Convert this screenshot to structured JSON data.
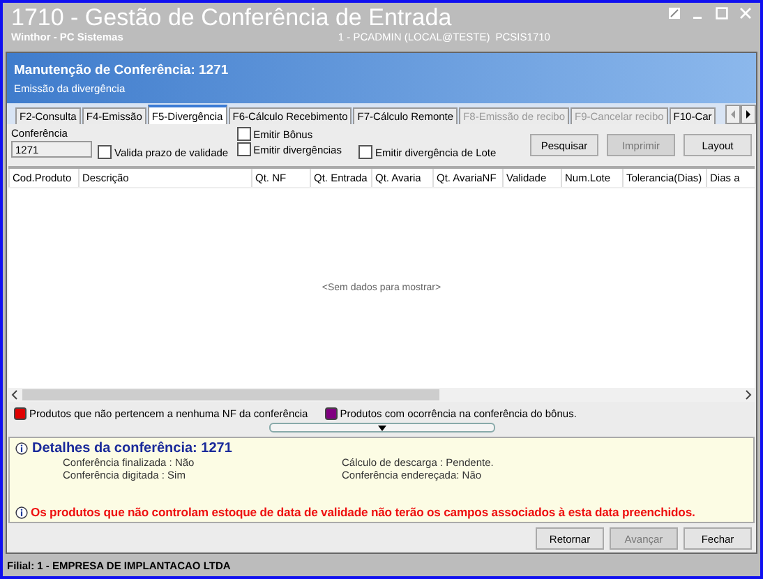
{
  "window": {
    "title": "1710 - Gestão de Conferência de Entrada",
    "subtitle": "Winthor - PC Sistemas",
    "session": "1 - PCADMIN (LOCAL@TESTE)",
    "program": "PCSIS1710"
  },
  "header": {
    "title": "Manutenção de Conferência: 1271",
    "subtitle": "Emissão da divergência"
  },
  "tabs": [
    {
      "label": "F2-Consulta",
      "selected": false,
      "disabled": false
    },
    {
      "label": "F4-Emissão",
      "selected": false,
      "disabled": false
    },
    {
      "label": "F5-Divergência",
      "selected": true,
      "disabled": false
    },
    {
      "label": "F6-Cálculo Recebimento",
      "selected": false,
      "disabled": false
    },
    {
      "label": "F7-Cálculo Remonte",
      "selected": false,
      "disabled": false
    },
    {
      "label": "F8-Emissão de recibo",
      "selected": false,
      "disabled": true
    },
    {
      "label": "F9-Cancelar recibo",
      "selected": false,
      "disabled": true
    },
    {
      "label": "F10-Car",
      "selected": false,
      "disabled": false
    }
  ],
  "form": {
    "field_label": "Conferência",
    "field_value": "1271",
    "checkboxes": [
      {
        "label": "Valida prazo de validade",
        "checked": false
      },
      {
        "label": "Emitir Bônus",
        "checked": false
      },
      {
        "label": "Emitir divergências",
        "checked": false
      },
      {
        "label": "Emitir divergência de Lote",
        "checked": false
      }
    ],
    "buttons": [
      {
        "label": "Pesquisar",
        "disabled": false
      },
      {
        "label": "Imprimir",
        "disabled": true
      },
      {
        "label": "Layout",
        "disabled": false
      }
    ]
  },
  "table": {
    "columns": [
      "Cod.Produto",
      "Descrição",
      "Qt. NF",
      "Qt. Entrada",
      "Qt. Avaria",
      "Qt. AvariaNF",
      "Validade",
      "Num.Lote",
      "Tolerancia(Dias)",
      "Dias a"
    ],
    "empty_message": "<Sem dados para mostrar>"
  },
  "legend": [
    {
      "label": "Produtos que não pertencem a nenhuma NF da conferência",
      "color": "#e00000"
    },
    {
      "label": "Produtos com ocorrência na conferência do bônus.",
      "color": "#800080"
    }
  ],
  "details": {
    "title": "Detalhes da conferência: 1271",
    "fields": [
      "Conferência finalizada : Não",
      "Cálculo de descarga : Pendente.",
      "Conferência digitada : Sim",
      "Conferência endereçada: Não"
    ],
    "warning": "Os produtos que não controlam estoque de data de validade não terão os campos associados à esta data preenchidos."
  },
  "footer_buttons": [
    {
      "label": "Retornar",
      "disabled": false
    },
    {
      "label": "Avançar",
      "disabled": true
    },
    {
      "label": "Fechar",
      "disabled": false
    }
  ],
  "status_bar": "Filial: 1 - EMPRESA DE IMPLANTACAO LTDA"
}
